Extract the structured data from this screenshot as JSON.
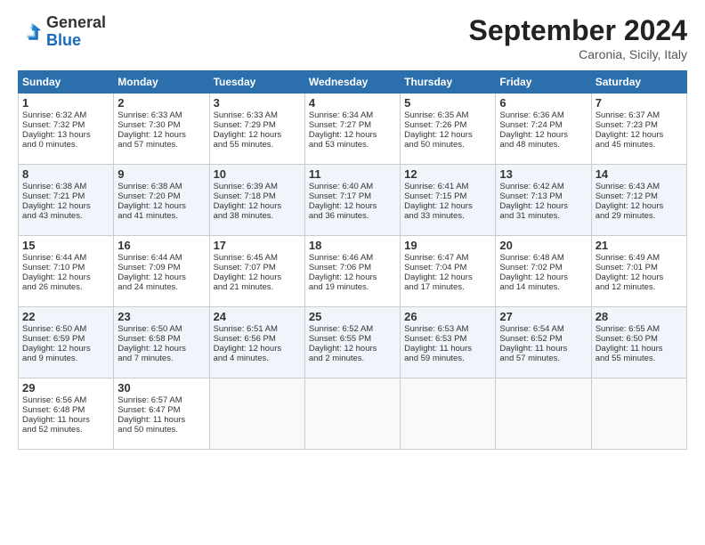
{
  "header": {
    "logo_general": "General",
    "logo_blue": "Blue",
    "month": "September 2024",
    "location": "Caronia, Sicily, Italy"
  },
  "days_of_week": [
    "Sunday",
    "Monday",
    "Tuesday",
    "Wednesday",
    "Thursday",
    "Friday",
    "Saturday"
  ],
  "weeks": [
    [
      {
        "day": "1",
        "lines": [
          "Sunrise: 6:32 AM",
          "Sunset: 7:32 PM",
          "Daylight: 13 hours",
          "and 0 minutes."
        ]
      },
      {
        "day": "2",
        "lines": [
          "Sunrise: 6:33 AM",
          "Sunset: 7:30 PM",
          "Daylight: 12 hours",
          "and 57 minutes."
        ]
      },
      {
        "day": "3",
        "lines": [
          "Sunrise: 6:33 AM",
          "Sunset: 7:29 PM",
          "Daylight: 12 hours",
          "and 55 minutes."
        ]
      },
      {
        "day": "4",
        "lines": [
          "Sunrise: 6:34 AM",
          "Sunset: 7:27 PM",
          "Daylight: 12 hours",
          "and 53 minutes."
        ]
      },
      {
        "day": "5",
        "lines": [
          "Sunrise: 6:35 AM",
          "Sunset: 7:26 PM",
          "Daylight: 12 hours",
          "and 50 minutes."
        ]
      },
      {
        "day": "6",
        "lines": [
          "Sunrise: 6:36 AM",
          "Sunset: 7:24 PM",
          "Daylight: 12 hours",
          "and 48 minutes."
        ]
      },
      {
        "day": "7",
        "lines": [
          "Sunrise: 6:37 AM",
          "Sunset: 7:23 PM",
          "Daylight: 12 hours",
          "and 45 minutes."
        ]
      }
    ],
    [
      {
        "day": "8",
        "lines": [
          "Sunrise: 6:38 AM",
          "Sunset: 7:21 PM",
          "Daylight: 12 hours",
          "and 43 minutes."
        ]
      },
      {
        "day": "9",
        "lines": [
          "Sunrise: 6:38 AM",
          "Sunset: 7:20 PM",
          "Daylight: 12 hours",
          "and 41 minutes."
        ]
      },
      {
        "day": "10",
        "lines": [
          "Sunrise: 6:39 AM",
          "Sunset: 7:18 PM",
          "Daylight: 12 hours",
          "and 38 minutes."
        ]
      },
      {
        "day": "11",
        "lines": [
          "Sunrise: 6:40 AM",
          "Sunset: 7:17 PM",
          "Daylight: 12 hours",
          "and 36 minutes."
        ]
      },
      {
        "day": "12",
        "lines": [
          "Sunrise: 6:41 AM",
          "Sunset: 7:15 PM",
          "Daylight: 12 hours",
          "and 33 minutes."
        ]
      },
      {
        "day": "13",
        "lines": [
          "Sunrise: 6:42 AM",
          "Sunset: 7:13 PM",
          "Daylight: 12 hours",
          "and 31 minutes."
        ]
      },
      {
        "day": "14",
        "lines": [
          "Sunrise: 6:43 AM",
          "Sunset: 7:12 PM",
          "Daylight: 12 hours",
          "and 29 minutes."
        ]
      }
    ],
    [
      {
        "day": "15",
        "lines": [
          "Sunrise: 6:44 AM",
          "Sunset: 7:10 PM",
          "Daylight: 12 hours",
          "and 26 minutes."
        ]
      },
      {
        "day": "16",
        "lines": [
          "Sunrise: 6:44 AM",
          "Sunset: 7:09 PM",
          "Daylight: 12 hours",
          "and 24 minutes."
        ]
      },
      {
        "day": "17",
        "lines": [
          "Sunrise: 6:45 AM",
          "Sunset: 7:07 PM",
          "Daylight: 12 hours",
          "and 21 minutes."
        ]
      },
      {
        "day": "18",
        "lines": [
          "Sunrise: 6:46 AM",
          "Sunset: 7:06 PM",
          "Daylight: 12 hours",
          "and 19 minutes."
        ]
      },
      {
        "day": "19",
        "lines": [
          "Sunrise: 6:47 AM",
          "Sunset: 7:04 PM",
          "Daylight: 12 hours",
          "and 17 minutes."
        ]
      },
      {
        "day": "20",
        "lines": [
          "Sunrise: 6:48 AM",
          "Sunset: 7:02 PM",
          "Daylight: 12 hours",
          "and 14 minutes."
        ]
      },
      {
        "day": "21",
        "lines": [
          "Sunrise: 6:49 AM",
          "Sunset: 7:01 PM",
          "Daylight: 12 hours",
          "and 12 minutes."
        ]
      }
    ],
    [
      {
        "day": "22",
        "lines": [
          "Sunrise: 6:50 AM",
          "Sunset: 6:59 PM",
          "Daylight: 12 hours",
          "and 9 minutes."
        ]
      },
      {
        "day": "23",
        "lines": [
          "Sunrise: 6:50 AM",
          "Sunset: 6:58 PM",
          "Daylight: 12 hours",
          "and 7 minutes."
        ]
      },
      {
        "day": "24",
        "lines": [
          "Sunrise: 6:51 AM",
          "Sunset: 6:56 PM",
          "Daylight: 12 hours",
          "and 4 minutes."
        ]
      },
      {
        "day": "25",
        "lines": [
          "Sunrise: 6:52 AM",
          "Sunset: 6:55 PM",
          "Daylight: 12 hours",
          "and 2 minutes."
        ]
      },
      {
        "day": "26",
        "lines": [
          "Sunrise: 6:53 AM",
          "Sunset: 6:53 PM",
          "Daylight: 11 hours",
          "and 59 minutes."
        ]
      },
      {
        "day": "27",
        "lines": [
          "Sunrise: 6:54 AM",
          "Sunset: 6:52 PM",
          "Daylight: 11 hours",
          "and 57 minutes."
        ]
      },
      {
        "day": "28",
        "lines": [
          "Sunrise: 6:55 AM",
          "Sunset: 6:50 PM",
          "Daylight: 11 hours",
          "and 55 minutes."
        ]
      }
    ],
    [
      {
        "day": "29",
        "lines": [
          "Sunrise: 6:56 AM",
          "Sunset: 6:48 PM",
          "Daylight: 11 hours",
          "and 52 minutes."
        ]
      },
      {
        "day": "30",
        "lines": [
          "Sunrise: 6:57 AM",
          "Sunset: 6:47 PM",
          "Daylight: 11 hours",
          "and 50 minutes."
        ]
      },
      null,
      null,
      null,
      null,
      null
    ]
  ]
}
